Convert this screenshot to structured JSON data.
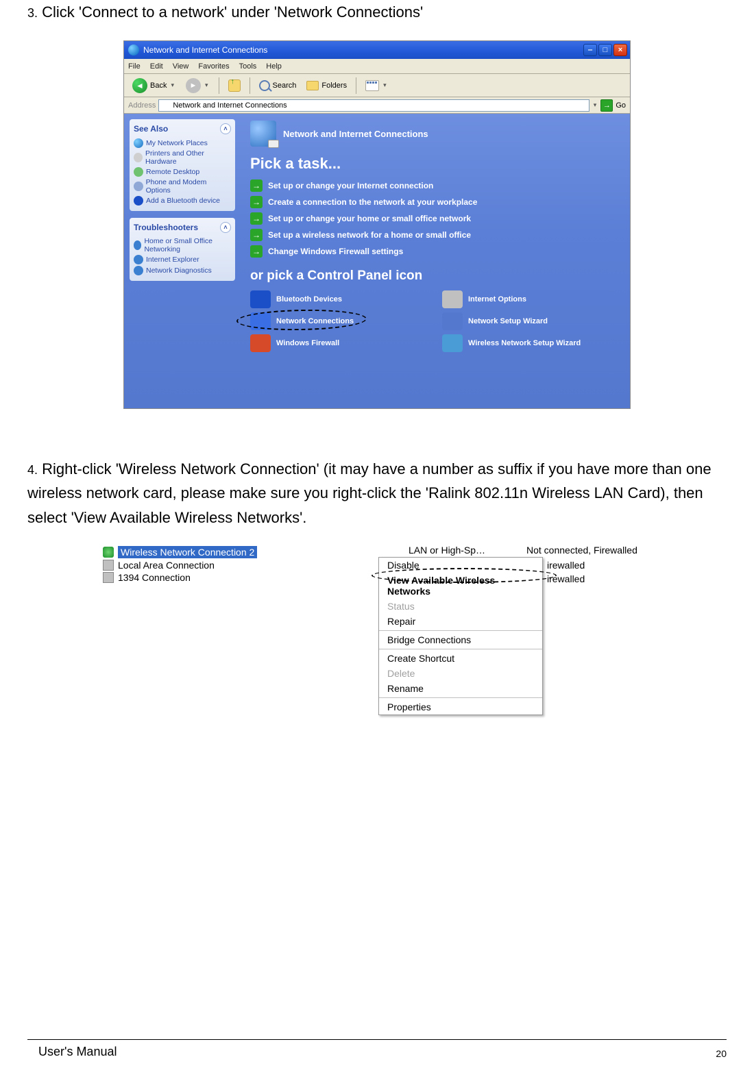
{
  "step3": {
    "num": "3.",
    "text": "Click 'Connect to a network' under 'Network Connections'"
  },
  "step4": {
    "num": "4.",
    "text": "Right-click 'Wireless Network Connection' (it may have a number as suffix if you have more than one wireless network card, please make sure you right-click the 'Ralink 802.11n Wireless LAN Card), then select 'View Available Wireless Networks'."
  },
  "shot1": {
    "title": "Network and Internet Connections",
    "menus": {
      "file": "File",
      "edit": "Edit",
      "view": "View",
      "favorites": "Favorites",
      "tools": "Tools",
      "help": "Help"
    },
    "toolbar": {
      "back": "Back",
      "search": "Search",
      "folders": "Folders"
    },
    "address": {
      "label": "Address",
      "value": "Network and Internet Connections",
      "go": "Go"
    },
    "seeAlso": {
      "title": "See Also",
      "items": {
        "places": "My Network Places",
        "printers": "Printers and Other Hardware",
        "remote": "Remote Desktop",
        "phone": "Phone and Modem Options",
        "bt": "Add a Bluetooth device"
      }
    },
    "trouble": {
      "title": "Troubleshooters",
      "items": {
        "home": "Home or Small Office Networking",
        "ie": "Internet Explorer",
        "diag": "Network Diagnostics"
      }
    },
    "headline": "Network and Internet Connections",
    "pick": "Pick a task...",
    "tasks": {
      "t1": "Set up or change your Internet connection",
      "t2": "Create a connection to the network at your workplace",
      "t3": "Set up or change your home or small office network",
      "t4": "Set up a wireless network for a home or small office",
      "t5": "Change Windows Firewall settings"
    },
    "orPick": "or pick a Control Panel icon",
    "icons": {
      "bt": "Bluetooth Devices",
      "io": "Internet Options",
      "nc": "Network Connections",
      "nsw": "Network Setup Wizard",
      "fw": "Windows Firewall",
      "wnsw": "Wireless Network Setup Wizard"
    }
  },
  "shot2": {
    "conns": {
      "wlan": "Wireless Network Connection 2",
      "lan": "Local Area Connection",
      "c1394": "1394 Connection"
    },
    "colType": "LAN or High-Sp…",
    "colStatus": "Not connected, Firewalled",
    "tail1": "irewalled",
    "tail2": "irewalled",
    "menu": {
      "disable": "Disable",
      "view": "View Available Wireless Networks",
      "status": "Status",
      "repair": "Repair",
      "bridge": "Bridge Connections",
      "shortcut": "Create Shortcut",
      "delete": "Delete",
      "rename": "Rename",
      "props": "Properties"
    }
  },
  "footer": {
    "manual": "User's Manual",
    "page": "20"
  }
}
